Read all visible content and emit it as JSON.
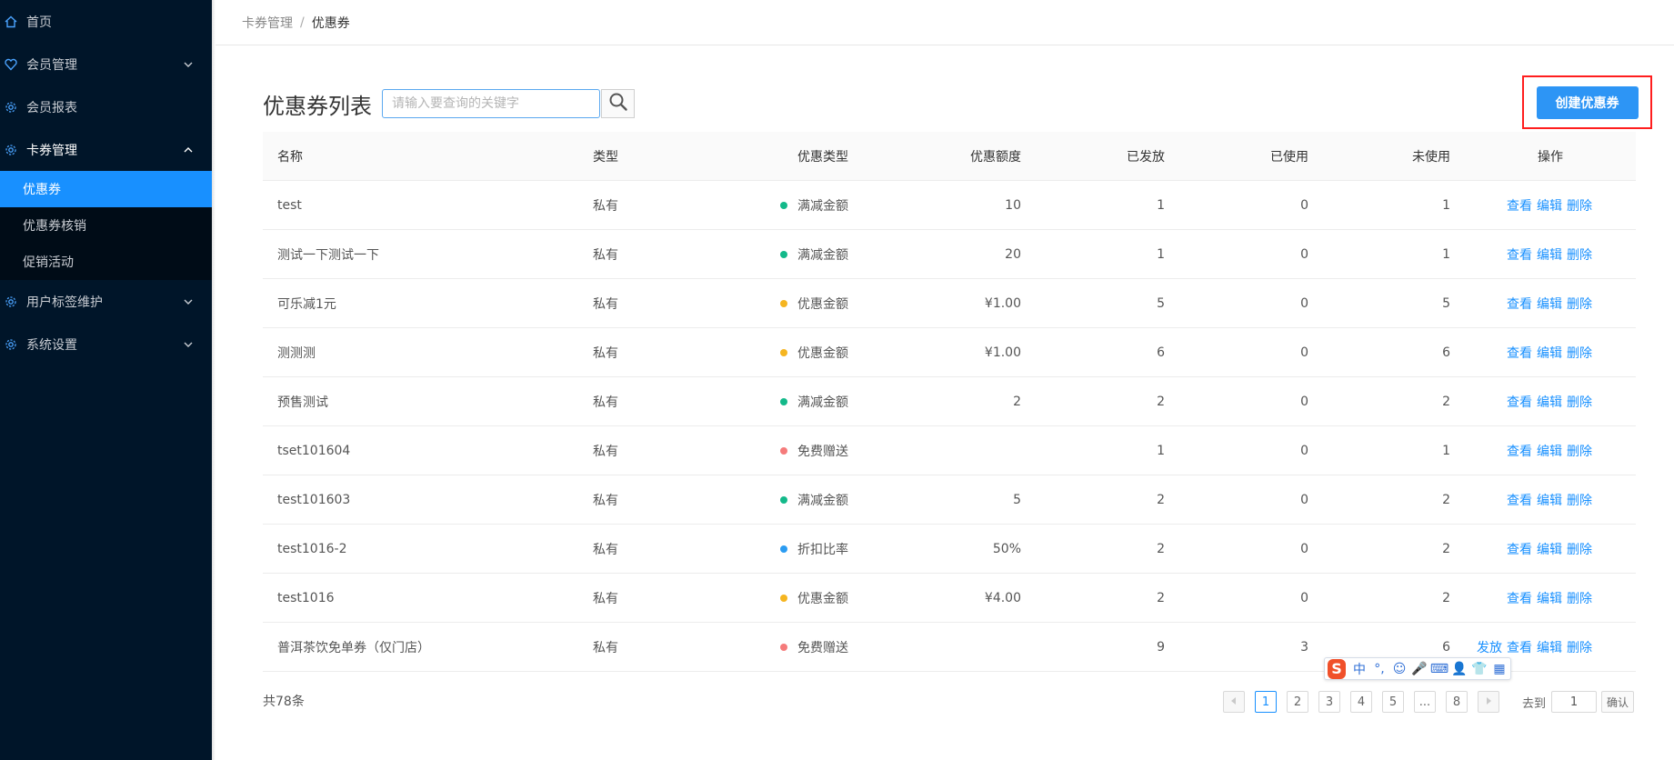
{
  "sidebar": {
    "items": [
      {
        "label": "首页"
      },
      {
        "label": "会员管理"
      },
      {
        "label": "会员报表"
      },
      {
        "label": "卡券管理"
      },
      {
        "label": "用户标签维护"
      },
      {
        "label": "系统设置"
      }
    ],
    "submenu": [
      {
        "label": "优惠券"
      },
      {
        "label": "优惠券核销"
      },
      {
        "label": "促销活动"
      }
    ]
  },
  "breadcrumb": {
    "parent": "卡券管理",
    "separator": "/",
    "current": "优惠券"
  },
  "page": {
    "title": "优惠券列表",
    "search_placeholder": "请输入要查询的关键字",
    "create_label": "创建优惠券"
  },
  "table": {
    "headers": {
      "name": "名称",
      "type": "类型",
      "discount_type": "优惠类型",
      "amount": "优惠额度",
      "issued": "已发放",
      "used": "已使用",
      "unused": "未使用",
      "ops": "操作"
    },
    "rows": [
      {
        "name": "test",
        "type": "私有",
        "discount_type": "满减金额",
        "dot": "#13b98a",
        "amount": "10",
        "issued": "1",
        "used": "0",
        "unused": "1",
        "ops": [
          "查看",
          "编辑",
          "删除"
        ]
      },
      {
        "name": "测试一下测试一下",
        "type": "私有",
        "discount_type": "满减金额",
        "dot": "#13b98a",
        "amount": "20",
        "issued": "1",
        "used": "0",
        "unused": "1",
        "ops": [
          "查看",
          "编辑",
          "删除"
        ]
      },
      {
        "name": "可乐减1元",
        "type": "私有",
        "discount_type": "优惠金额",
        "dot": "#f5b520",
        "amount": "¥1.00",
        "issued": "5",
        "used": "0",
        "unused": "5",
        "ops": [
          "查看",
          "编辑",
          "删除"
        ]
      },
      {
        "name": "测测测",
        "type": "私有",
        "discount_type": "优惠金额",
        "dot": "#f5b520",
        "amount": "¥1.00",
        "issued": "6",
        "used": "0",
        "unused": "6",
        "ops": [
          "查看",
          "编辑",
          "删除"
        ]
      },
      {
        "name": "预售测试",
        "type": "私有",
        "discount_type": "满减金额",
        "dot": "#13b98a",
        "amount": "2",
        "issued": "2",
        "used": "0",
        "unused": "2",
        "ops": [
          "查看",
          "编辑",
          "删除"
        ]
      },
      {
        "name": "tset101604",
        "type": "私有",
        "discount_type": "免费赠送",
        "dot": "#f57b7b",
        "amount": "",
        "issued": "1",
        "used": "0",
        "unused": "1",
        "ops": [
          "查看",
          "编辑",
          "删除"
        ]
      },
      {
        "name": "test101603",
        "type": "私有",
        "discount_type": "满减金额",
        "dot": "#13b98a",
        "amount": "5",
        "issued": "2",
        "used": "0",
        "unused": "2",
        "ops": [
          "查看",
          "编辑",
          "删除"
        ]
      },
      {
        "name": "test1016-2",
        "type": "私有",
        "discount_type": "折扣比率",
        "dot": "#2b9cf2",
        "amount": "50%",
        "issued": "2",
        "used": "0",
        "unused": "2",
        "ops": [
          "查看",
          "编辑",
          "删除"
        ]
      },
      {
        "name": "test1016",
        "type": "私有",
        "discount_type": "优惠金额",
        "dot": "#f5b520",
        "amount": "¥4.00",
        "issued": "2",
        "used": "0",
        "unused": "2",
        "ops": [
          "查看",
          "编辑",
          "删除"
        ]
      },
      {
        "name": "普洱茶饮免单券（仅门店）",
        "type": "私有",
        "discount_type": "免费赠送",
        "dot": "#f57b7b",
        "amount": "",
        "issued": "9",
        "used": "3",
        "unused": "6",
        "ops": [
          "发放",
          "查看",
          "编辑",
          "删除"
        ]
      }
    ]
  },
  "footer": {
    "total": "共78条",
    "pages": [
      "1",
      "2",
      "3",
      "4",
      "5",
      "...",
      "8"
    ],
    "current_page": "1",
    "goto_label": "去到",
    "goto_value": "1",
    "confirm_label": "确认"
  },
  "ime": {
    "logo": "S",
    "items": [
      "中",
      "°,",
      "☺",
      "🎤",
      "⌨",
      "👤",
      "👕",
      "▦"
    ]
  }
}
